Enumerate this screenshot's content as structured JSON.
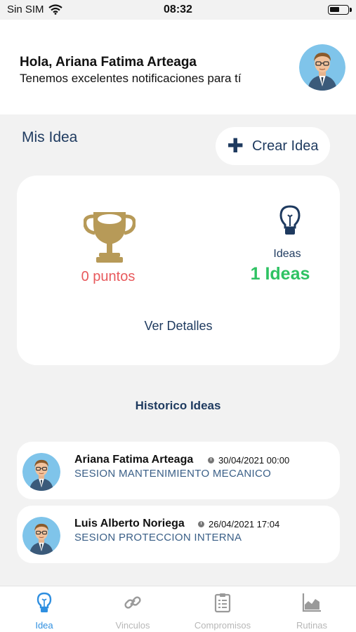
{
  "status": {
    "carrier": "Sin SIM",
    "time": "08:32",
    "battery_level": 0.55
  },
  "header": {
    "greeting": "Hola, Ariana Fatima Arteaga",
    "subtitle": "Tenemos excelentes notificaciones para tí",
    "avatar_icon": "user-avatar-icon"
  },
  "ideas_section": {
    "title": "Mis Idea",
    "create_label": "Crear Idea",
    "create_icon": "plus-icon"
  },
  "stats": {
    "points": "0 puntos",
    "ideas_label": "Ideas",
    "ideas_count": "1 Ideas",
    "details_label": "Ver Detalles",
    "trophy_icon": "trophy-icon",
    "bulb_icon": "lightbulb-icon",
    "colors": {
      "trophy": "#b79a58",
      "points": "#e8595c",
      "ideas_count": "#2ec263",
      "navy": "#1e3a5f"
    }
  },
  "history": {
    "title": "Historico Ideas",
    "items": [
      {
        "name": "Ariana Fatima Arteaga",
        "date": "30/04/2021 00:00",
        "session": "SESION MANTENIMIENTO MECANICO"
      },
      {
        "name": "Luis Alberto Noriega",
        "date": "26/04/2021 17:04",
        "session": "SESION PROTECCION INTERNA"
      }
    ]
  },
  "tabs": [
    {
      "label": "Idea",
      "icon": "lightbulb-icon",
      "active": true
    },
    {
      "label": "Vinculos",
      "icon": "link-icon",
      "active": false
    },
    {
      "label": "Compromisos",
      "icon": "clipboard-icon",
      "active": false
    },
    {
      "label": "Rutinas",
      "icon": "chart-icon",
      "active": false
    }
  ],
  "accent_color": "#2f8fe0"
}
